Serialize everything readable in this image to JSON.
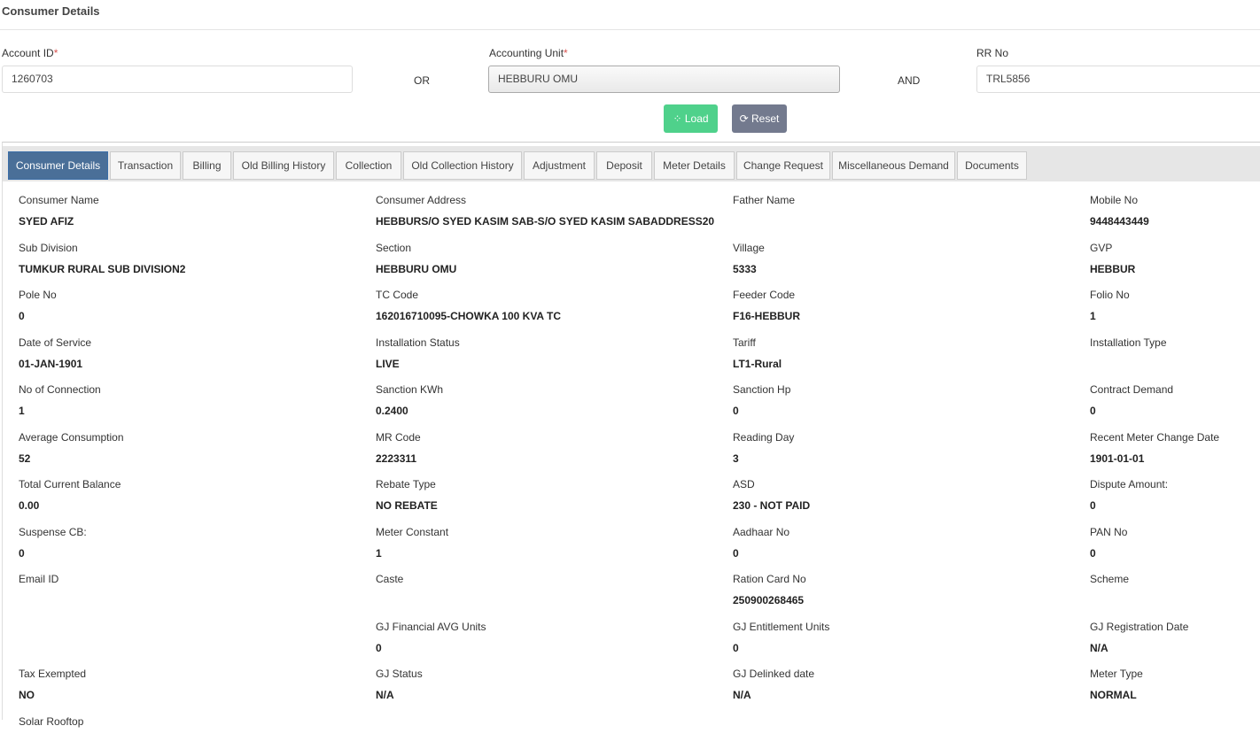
{
  "page_title": "Consumer Details",
  "form": {
    "account_id_label": "Account ID",
    "account_id_value": "1260703",
    "required_mark": "*",
    "or_label": "OR",
    "accounting_unit_label": "Accounting Unit",
    "accounting_unit_value": "HEBBURU OMU",
    "and_label": "AND",
    "rr_no_label": "RR No",
    "rr_no_value": "TRL5856",
    "load_label": "Load",
    "reset_label": "Reset"
  },
  "tabs": [
    "Consumer Details",
    "Transaction",
    "Billing",
    "Old Billing History",
    "Collection",
    "Old Collection History",
    "Adjustment",
    "Deposit",
    "Meter Details",
    "Change Request",
    "Miscellaneous Demand",
    "Documents"
  ],
  "fields": [
    [
      [
        "Consumer Name",
        "SYED AFIZ"
      ],
      [
        "Consumer Address",
        "HEBBURS/O SYED KASIM SAB-S/O SYED KASIM SABADDRESS20"
      ],
      [
        "Father Name",
        ""
      ],
      [
        "Mobile No",
        "9448443449"
      ]
    ],
    [
      [
        "Sub Division",
        "TUMKUR RURAL SUB DIVISION2"
      ],
      [
        "Section",
        "HEBBURU OMU"
      ],
      [
        "Village",
        "5333"
      ],
      [
        "GVP",
        "HEBBUR"
      ]
    ],
    [
      [
        "Pole No",
        "0"
      ],
      [
        "TC Code",
        "162016710095-CHOWKA 100 KVA TC"
      ],
      [
        "Feeder Code",
        "F16-HEBBUR"
      ],
      [
        "Folio No",
        "1"
      ]
    ],
    [
      [
        "Date of Service",
        "01-JAN-1901"
      ],
      [
        "Installation Status",
        "LIVE"
      ],
      [
        "Tariff",
        "LT1-Rural"
      ],
      [
        "Installation Type",
        ""
      ]
    ],
    [
      [
        "No of Connection",
        "1"
      ],
      [
        "Sanction KWh",
        "0.2400"
      ],
      [
        "Sanction Hp",
        "0"
      ],
      [
        "Contract Demand",
        "0"
      ]
    ],
    [
      [
        "Average Consumption",
        "52"
      ],
      [
        "MR Code",
        "2223311"
      ],
      [
        "Reading Day",
        "3"
      ],
      [
        "Recent Meter Change Date",
        "1901-01-01"
      ]
    ],
    [
      [
        "Total Current Balance",
        "0.00"
      ],
      [
        "Rebate Type",
        "NO REBATE"
      ],
      [
        "ASD",
        "230 - NOT PAID"
      ],
      [
        "Dispute Amount:",
        "0"
      ]
    ],
    [
      [
        "Suspense CB:",
        "0"
      ],
      [
        "Meter Constant",
        "1"
      ],
      [
        "Aadhaar No",
        "0"
      ],
      [
        "PAN No",
        "0"
      ]
    ],
    [
      [
        "Email ID",
        ""
      ],
      [
        "Caste",
        ""
      ],
      [
        "Ration Card No",
        "250900268465"
      ],
      [
        "Scheme",
        ""
      ]
    ],
    [
      null,
      [
        "GJ Financial AVG Units",
        "0"
      ],
      [
        "GJ Entitlement Units",
        "0"
      ],
      [
        "GJ Registration Date",
        "N/A"
      ]
    ],
    [
      [
        "Tax Exempted",
        "NO"
      ],
      [
        "GJ Status",
        "N/A"
      ],
      [
        "GJ Delinked date",
        "N/A"
      ],
      [
        "Meter Type",
        "NORMAL"
      ]
    ],
    [
      [
        "Solar Rooftop",
        ""
      ],
      null,
      null,
      null
    ]
  ]
}
